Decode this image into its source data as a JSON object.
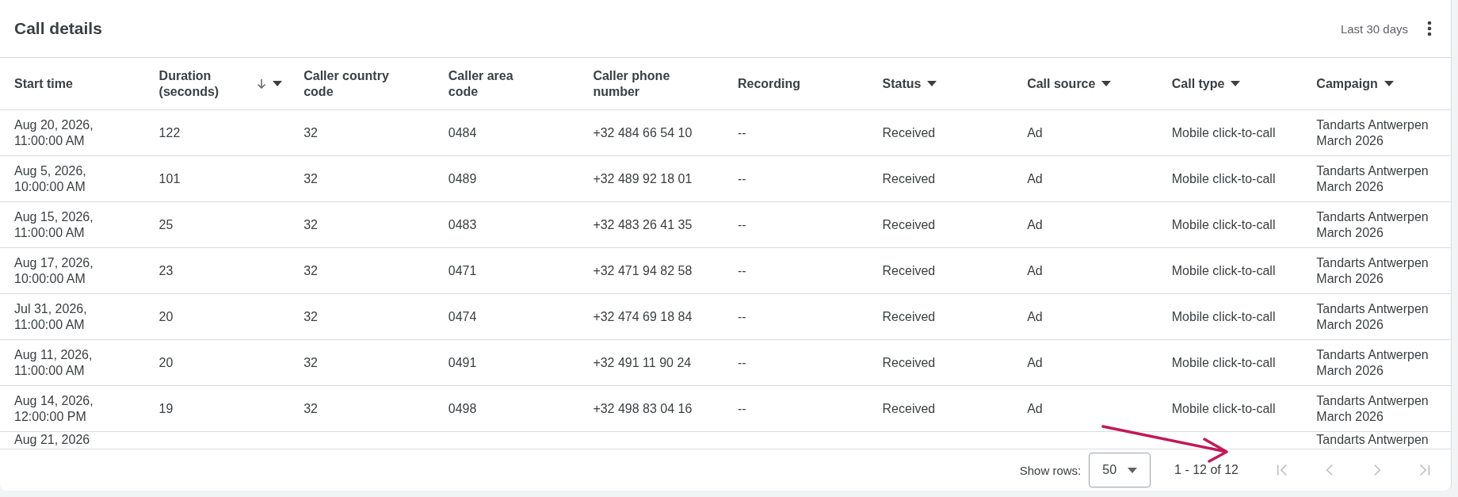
{
  "card": {
    "title": "Call details",
    "date_range": "Last 30 days"
  },
  "table": {
    "columns": [
      {
        "label": "Start time",
        "sorted": false,
        "filter": false
      },
      {
        "label": "Duration (seconds)",
        "sorted": true,
        "filter": true
      },
      {
        "label": "Caller country code",
        "sorted": false,
        "filter": false
      },
      {
        "label": "Caller area code",
        "sorted": false,
        "filter": false
      },
      {
        "label": "Caller phone number",
        "sorted": false,
        "filter": false
      },
      {
        "label": "Recording",
        "sorted": false,
        "filter": false
      },
      {
        "label": "Status",
        "sorted": false,
        "filter": true
      },
      {
        "label": "Call source",
        "sorted": false,
        "filter": true
      },
      {
        "label": "Call type",
        "sorted": false,
        "filter": true
      },
      {
        "label": "Campaign",
        "sorted": false,
        "filter": true
      }
    ],
    "rows": [
      [
        "Aug 20, 2026, 11:00:00 AM",
        "122",
        "32",
        "0484",
        "+32 484 66 54 10",
        "--",
        "Received",
        "Ad",
        "Mobile click-to-call",
        "Tandarts Antwerpen March 2026"
      ],
      [
        "Aug 5, 2026, 10:00:00 AM",
        "101",
        "32",
        "0489",
        "+32 489 92 18 01",
        "--",
        "Received",
        "Ad",
        "Mobile click-to-call",
        "Tandarts Antwerpen March 2026"
      ],
      [
        "Aug 15, 2026, 11:00:00 AM",
        "25",
        "32",
        "0483",
        "+32 483 26 41 35",
        "--",
        "Received",
        "Ad",
        "Mobile click-to-call",
        "Tandarts Antwerpen March 2026"
      ],
      [
        "Aug 17, 2026, 10:00:00 AM",
        "23",
        "32",
        "0471",
        "+32 471 94 82 58",
        "--",
        "Received",
        "Ad",
        "Mobile click-to-call",
        "Tandarts Antwerpen March 2026"
      ],
      [
        "Jul 31, 2026, 11:00:00 AM",
        "20",
        "32",
        "0474",
        "+32 474 69 18 84",
        "--",
        "Received",
        "Ad",
        "Mobile click-to-call",
        "Tandarts Antwerpen March 2026"
      ],
      [
        "Aug 11, 2026, 11:00:00 AM",
        "20",
        "32",
        "0491",
        "+32 491 11 90 24",
        "--",
        "Received",
        "Ad",
        "Mobile click-to-call",
        "Tandarts Antwerpen March 2026"
      ],
      [
        "Aug 14, 2026, 12:00:00 PM",
        "19",
        "32",
        "0498",
        "+32 498 83 04 16",
        "--",
        "Received",
        "Ad",
        "Mobile click-to-call",
        "Tandarts Antwerpen March 2026"
      ],
      [
        "Aug 21, 2026",
        "",
        "",
        "",
        "",
        "",
        "",
        "",
        "",
        "Tandarts Antwerpen"
      ]
    ]
  },
  "pagination": {
    "rows_label": "Show rows:",
    "rows_value": "50",
    "range": "1 - 12 of 12",
    "buttons": [
      {
        "kind": "first",
        "disabled": true
      },
      {
        "kind": "prev",
        "disabled": true
      },
      {
        "kind": "next",
        "disabled": true
      },
      {
        "kind": "last",
        "disabled": true
      }
    ]
  }
}
